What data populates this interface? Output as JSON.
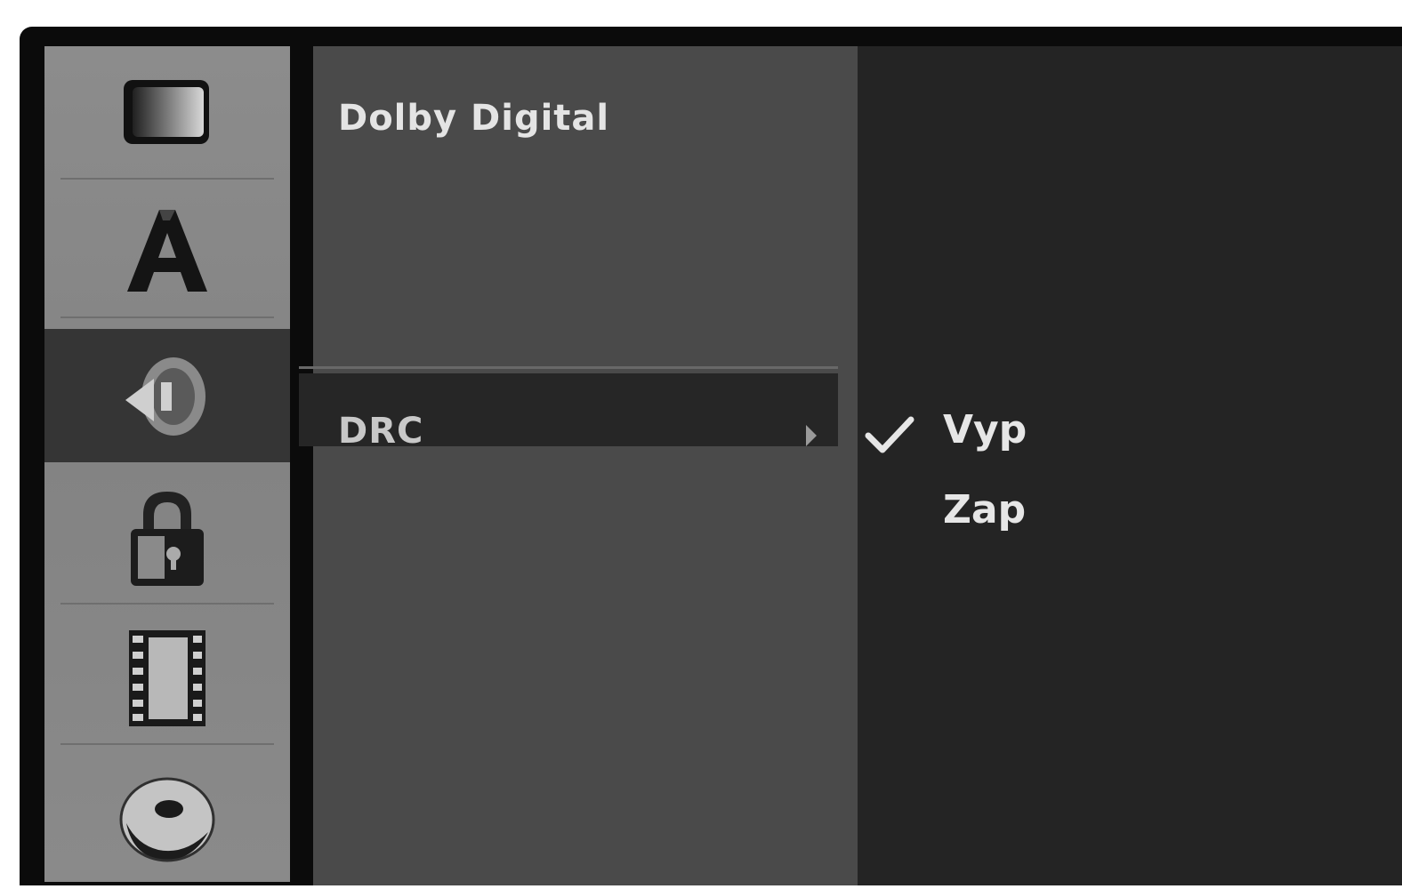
{
  "sidebar": {
    "items": [
      {
        "name": "tv-icon",
        "active": false
      },
      {
        "name": "language-icon",
        "active": false
      },
      {
        "name": "audio-icon",
        "active": true
      },
      {
        "name": "lock-icon",
        "active": false
      },
      {
        "name": "film-icon",
        "active": false
      },
      {
        "name": "disc-icon",
        "active": false
      }
    ]
  },
  "menu": {
    "items": [
      {
        "label": "Dolby Digital",
        "state": "enabled"
      },
      {
        "label": "",
        "state": "dimmed"
      },
      {
        "label": "",
        "state": "dimmed"
      },
      {
        "label": "",
        "state": "dimmed"
      },
      {
        "label": "DRC",
        "state": "selected"
      },
      {
        "label": "",
        "state": "dimmed"
      }
    ]
  },
  "submenu": {
    "options": [
      {
        "label": "Vyp",
        "checked": true
      },
      {
        "label": "Zap",
        "checked": false
      }
    ]
  },
  "colors": {
    "sidebar_bg": "#8c8c8c",
    "sidebar_active": "#353535",
    "menu_bg": "#4a4a4a",
    "menu_highlight": "#262626",
    "submenu_bg": "#242424",
    "text_bright": "#e4e4e4",
    "text_dim": "#5e5e5e"
  }
}
